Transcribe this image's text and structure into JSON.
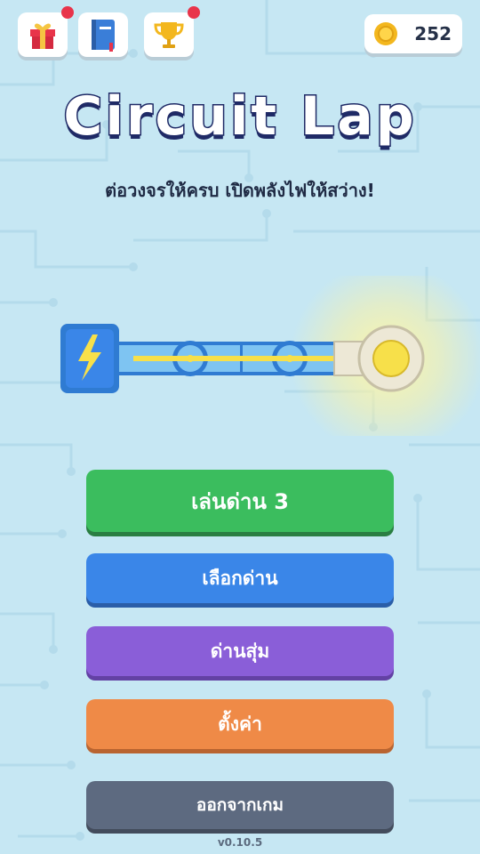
{
  "game": {
    "title": "Circuit Lap",
    "subtitle": "ต่อวงจรให้ครบ เปิดพลังไฟให้สว่าง!",
    "version": "v0.10.5"
  },
  "top_bar": {
    "gift": {
      "icon": "gift-icon",
      "has_notification": true
    },
    "journal": {
      "icon": "book-icon",
      "has_notification": false
    },
    "achievements": {
      "icon": "trophy-icon",
      "has_notification": true
    },
    "coins": {
      "icon": "coin-icon",
      "count": "252"
    }
  },
  "menu": {
    "play_label": "เล่นด่าน 3",
    "select_level_label": "เลือกด่าน",
    "random_level_label": "ด่านสุ่ม",
    "settings_label": "ตั้งค่า",
    "exit_label": "ออกจากเกม"
  },
  "colors": {
    "background": "#c6e7f3",
    "play": "#3bbd5e",
    "select": "#3a86e8",
    "random": "#8a5ed8",
    "settings": "#ef8a47",
    "exit": "#5d6a80",
    "notification": "#e8344a",
    "wire_glow": "#f7e04a"
  }
}
